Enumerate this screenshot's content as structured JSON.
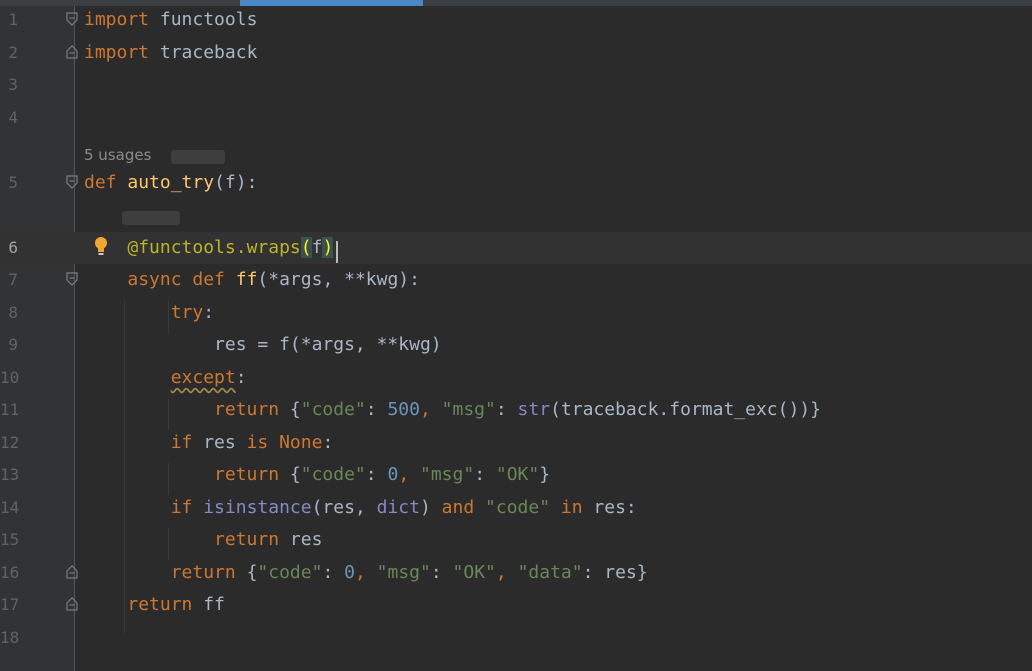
{
  "editor": {
    "usages_hint": "5 usages",
    "lines": [
      {
        "num": "1",
        "tokens": [
          {
            "t": "import",
            "c": "kw"
          },
          {
            "t": " functools",
            "c": ""
          }
        ]
      },
      {
        "num": "2",
        "tokens": [
          {
            "t": "import",
            "c": "kw"
          },
          {
            "t": " traceback",
            "c": ""
          }
        ]
      },
      {
        "num": "3",
        "tokens": []
      },
      {
        "num": "4",
        "tokens": []
      },
      {
        "num": "5",
        "tokens": [
          {
            "t": "def ",
            "c": "kw"
          },
          {
            "t": "auto_try",
            "c": "fn"
          },
          {
            "t": "(f):",
            "c": ""
          }
        ]
      },
      {
        "num": "6",
        "tokens": [
          {
            "t": "    ",
            "c": ""
          },
          {
            "t": "@functools.wraps",
            "c": "deco"
          },
          {
            "t": "(",
            "c": "match"
          },
          {
            "t": "f",
            "c": ""
          },
          {
            "t": ")",
            "c": "match"
          }
        ]
      },
      {
        "num": "7",
        "tokens": [
          {
            "t": "    ",
            "c": ""
          },
          {
            "t": "async def ",
            "c": "kw"
          },
          {
            "t": "ff",
            "c": "fn"
          },
          {
            "t": "(*args, **kwg):",
            "c": ""
          }
        ]
      },
      {
        "num": "8",
        "tokens": [
          {
            "t": "        ",
            "c": ""
          },
          {
            "t": "try",
            "c": "kw"
          },
          {
            "t": ":",
            "c": ""
          }
        ]
      },
      {
        "num": "9",
        "tokens": [
          {
            "t": "            res = f(*args, **kwg)",
            "c": ""
          }
        ]
      },
      {
        "num": "10",
        "tokens": [
          {
            "t": "        ",
            "c": ""
          },
          {
            "t": "except",
            "c": "kw sq"
          },
          {
            "t": ":",
            "c": ""
          }
        ]
      },
      {
        "num": "11",
        "tokens": [
          {
            "t": "            ",
            "c": ""
          },
          {
            "t": "return ",
            "c": "kw"
          },
          {
            "t": "{",
            "c": ""
          },
          {
            "t": "\"code\"",
            "c": "str"
          },
          {
            "t": ": ",
            "c": ""
          },
          {
            "t": "500",
            "c": "num"
          },
          {
            "t": ", ",
            "c": "kw"
          },
          {
            "t": "\"msg\"",
            "c": "str"
          },
          {
            "t": ": ",
            "c": ""
          },
          {
            "t": "str",
            "c": "bi"
          },
          {
            "t": "(traceback.format_exc())}",
            "c": ""
          }
        ]
      },
      {
        "num": "12",
        "tokens": [
          {
            "t": "        ",
            "c": ""
          },
          {
            "t": "if ",
            "c": "kw"
          },
          {
            "t": "res ",
            "c": ""
          },
          {
            "t": "is None",
            "c": "kw"
          },
          {
            "t": ":",
            "c": ""
          }
        ]
      },
      {
        "num": "13",
        "tokens": [
          {
            "t": "            ",
            "c": ""
          },
          {
            "t": "return ",
            "c": "kw"
          },
          {
            "t": "{",
            "c": ""
          },
          {
            "t": "\"code\"",
            "c": "str"
          },
          {
            "t": ": ",
            "c": ""
          },
          {
            "t": "0",
            "c": "num"
          },
          {
            "t": ", ",
            "c": "kw"
          },
          {
            "t": "\"msg\"",
            "c": "str"
          },
          {
            "t": ": ",
            "c": ""
          },
          {
            "t": "\"OK\"",
            "c": "str"
          },
          {
            "t": "}",
            "c": ""
          }
        ]
      },
      {
        "num": "14",
        "tokens": [
          {
            "t": "        ",
            "c": ""
          },
          {
            "t": "if ",
            "c": "kw"
          },
          {
            "t": "isinstance",
            "c": "bi"
          },
          {
            "t": "(res, ",
            "c": ""
          },
          {
            "t": "dict",
            "c": "bi"
          },
          {
            "t": ") ",
            "c": ""
          },
          {
            "t": "and ",
            "c": "kw"
          },
          {
            "t": "\"code\"",
            "c": "str"
          },
          {
            "t": " ",
            "c": ""
          },
          {
            "t": "in ",
            "c": "kw"
          },
          {
            "t": "res:",
            "c": ""
          }
        ]
      },
      {
        "num": "15",
        "tokens": [
          {
            "t": "            ",
            "c": ""
          },
          {
            "t": "return ",
            "c": "kw"
          },
          {
            "t": "res",
            "c": ""
          }
        ]
      },
      {
        "num": "16",
        "tokens": [
          {
            "t": "        ",
            "c": ""
          },
          {
            "t": "return ",
            "c": "kw"
          },
          {
            "t": "{",
            "c": ""
          },
          {
            "t": "\"code\"",
            "c": "str"
          },
          {
            "t": ": ",
            "c": ""
          },
          {
            "t": "0",
            "c": "num"
          },
          {
            "t": ", ",
            "c": "kw"
          },
          {
            "t": "\"msg\"",
            "c": "str"
          },
          {
            "t": ": ",
            "c": ""
          },
          {
            "t": "\"OK\"",
            "c": "str"
          },
          {
            "t": ", ",
            "c": "kw"
          },
          {
            "t": "\"data\"",
            "c": "str"
          },
          {
            "t": ": res}",
            "c": ""
          }
        ]
      },
      {
        "num": "17",
        "tokens": [
          {
            "t": "    ",
            "c": ""
          },
          {
            "t": "return ",
            "c": "kw"
          },
          {
            "t": "ff",
            "c": ""
          }
        ]
      },
      {
        "num": "18",
        "tokens": []
      }
    ]
  },
  "colors": {
    "background": "#2b2b2b",
    "keyword": "#cc7832",
    "function": "#ffc66d",
    "string": "#6a8759",
    "number": "#6897bb",
    "builtin": "#8888c6",
    "decorator": "#bbb529"
  },
  "icons": {
    "fold_marker": "fold-icon",
    "intention": "lightbulb-icon"
  }
}
